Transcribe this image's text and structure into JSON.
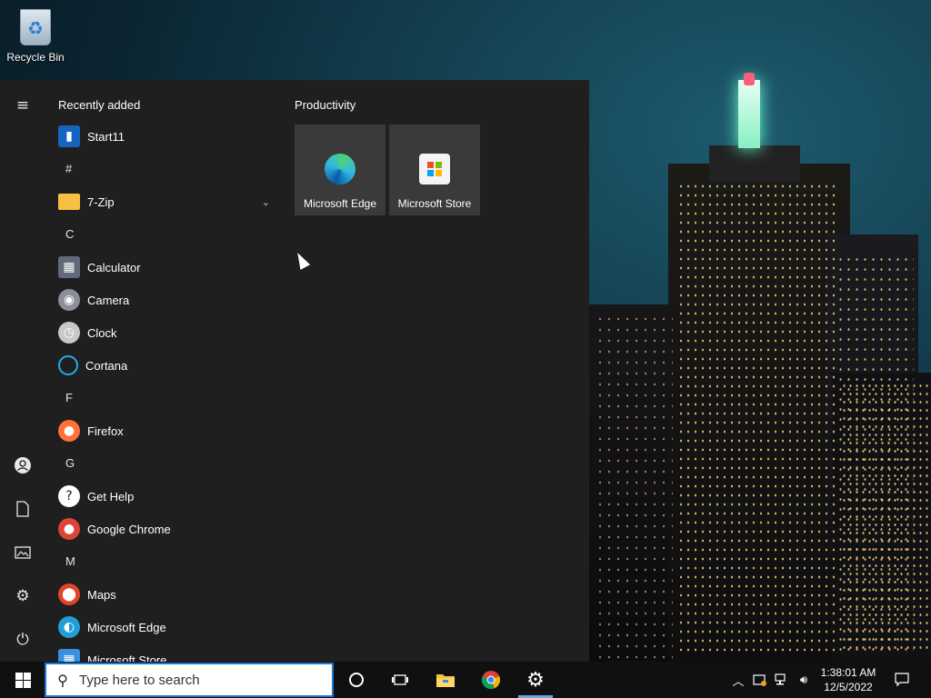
{
  "desktop": {
    "recycle_bin_label": "Recycle Bin"
  },
  "start_menu": {
    "section_header": "Recently added",
    "items": [
      {
        "kind": "app",
        "name": "Start11",
        "icon": "start11-icon",
        "color": "#1565c0"
      },
      {
        "kind": "letter",
        "name": "#"
      },
      {
        "kind": "app",
        "name": "7-Zip",
        "icon": "folder-icon",
        "color": "#f6c142",
        "expandable": true
      },
      {
        "kind": "letter",
        "name": "C"
      },
      {
        "kind": "app",
        "name": "Calculator",
        "icon": "calculator-icon",
        "color": "#5f6b78"
      },
      {
        "kind": "app",
        "name": "Camera",
        "icon": "camera-icon",
        "color": "#8a8f98"
      },
      {
        "kind": "app",
        "name": "Clock",
        "icon": "clock-icon",
        "color": "#c8c8c8"
      },
      {
        "kind": "app",
        "name": "Cortana",
        "icon": "cortana-icon",
        "color": "#2aa6f0"
      },
      {
        "kind": "letter",
        "name": "F"
      },
      {
        "kind": "app",
        "name": "Firefox",
        "icon": "firefox-icon",
        "color": "#ff7139"
      },
      {
        "kind": "letter",
        "name": "G"
      },
      {
        "kind": "app",
        "name": "Get Help",
        "icon": "get-help-icon",
        "color": "#ffffff"
      },
      {
        "kind": "app",
        "name": "Google Chrome",
        "icon": "chrome-icon",
        "color": "#db4437"
      },
      {
        "kind": "letter",
        "name": "M"
      },
      {
        "kind": "app",
        "name": "Maps",
        "icon": "maps-icon",
        "color": "#e0452b"
      },
      {
        "kind": "app",
        "name": "Microsoft Edge",
        "icon": "edge-icon",
        "color": "#1f9fd6"
      },
      {
        "kind": "app",
        "name": "Microsoft Store",
        "icon": "store-icon",
        "color": "#3a8fe0"
      }
    ],
    "tiles_group": "Productivity",
    "tiles": [
      {
        "name": "Microsoft Edge",
        "icon": "edge-icon",
        "color": "#1f9fd6"
      },
      {
        "name": "Microsoft Store",
        "icon": "store-icon",
        "color": "#f4f4f4"
      }
    ]
  },
  "taskbar": {
    "search_placeholder": "Type here to search",
    "pinned": [
      "cortana-icon",
      "task-view-icon",
      "file-explorer-icon",
      "chrome-icon",
      "settings-icon"
    ],
    "active_app": "settings-icon",
    "tray": {
      "time": "1:38:01 AM",
      "date": "12/5/2022"
    },
    "accent_color": "#1976d2"
  }
}
